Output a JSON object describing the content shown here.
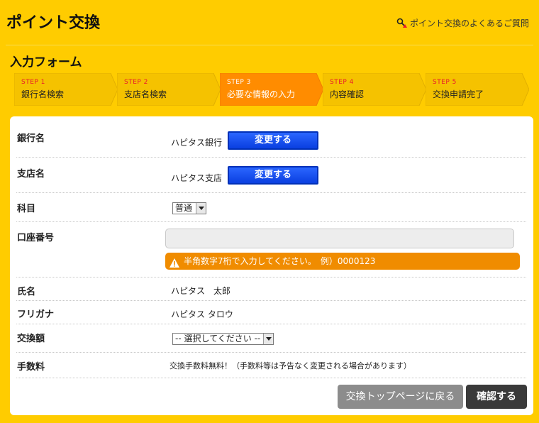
{
  "header": {
    "title": "ポイント交換",
    "faq_link": "ポイント交換のよくあるご質問"
  },
  "section_title": "入力フォーム",
  "steps": [
    {
      "num": "STEP 1",
      "label": "銀行名検索",
      "state": "done"
    },
    {
      "num": "STEP 2",
      "label": "支店名検索",
      "state": "done"
    },
    {
      "num": "STEP 3",
      "label": "必要な情報の入力",
      "state": "active"
    },
    {
      "num": "STEP 4",
      "label": "内容確認",
      "state": "pending"
    },
    {
      "num": "STEP 5",
      "label": "交換申請完了",
      "state": "pending"
    }
  ],
  "form": {
    "bank": {
      "label": "銀行名",
      "value": "ハピタス銀行",
      "button": "変更する"
    },
    "branch": {
      "label": "支店名",
      "value": "ハピタス支店",
      "button": "変更する"
    },
    "account_type": {
      "label": "科目",
      "selected": "普通"
    },
    "account_number": {
      "label": "口座番号",
      "value": "",
      "warning": "半角数字7桁で入力してください。　例）0000123"
    },
    "name": {
      "label": "氏名",
      "value": "ハピタス　太郎"
    },
    "furigana": {
      "label": "フリガナ",
      "value": "ハピタス タロウ"
    },
    "amount": {
      "label": "交換額",
      "selected": "-- 選択してください --"
    },
    "fee": {
      "label": "手数料",
      "value": "交換手数料無料！（手数料等は予告なく変更される場合があります）"
    }
  },
  "buttons": {
    "back": "交換トップページに戻る",
    "confirm": "確認する"
  },
  "colors": {
    "background": "#ffcc00",
    "step_done": "#f5c200",
    "step_active": "#ff8c00",
    "change_button": "#0a3fe0",
    "warning": "#f08c00"
  }
}
